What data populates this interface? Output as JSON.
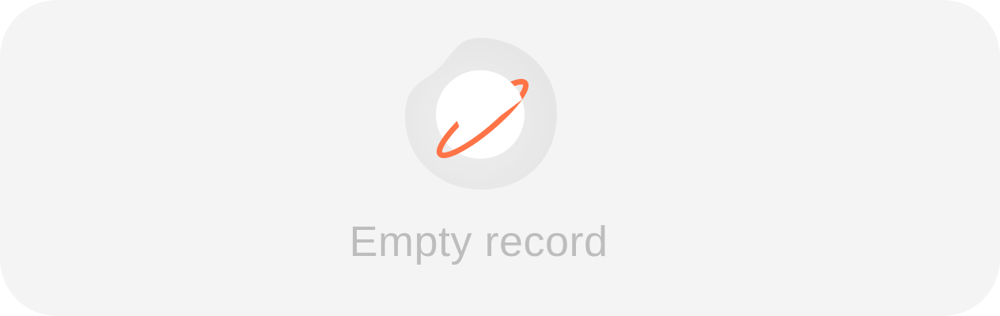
{
  "empty_state": {
    "message": "Empty record",
    "icon": "planet-icon",
    "colors": {
      "background": "#f4f4f4",
      "blob": "#e6e6e6",
      "planet": "#ffffff",
      "ring": "#ff7447",
      "text": "#bdbdbd"
    }
  }
}
